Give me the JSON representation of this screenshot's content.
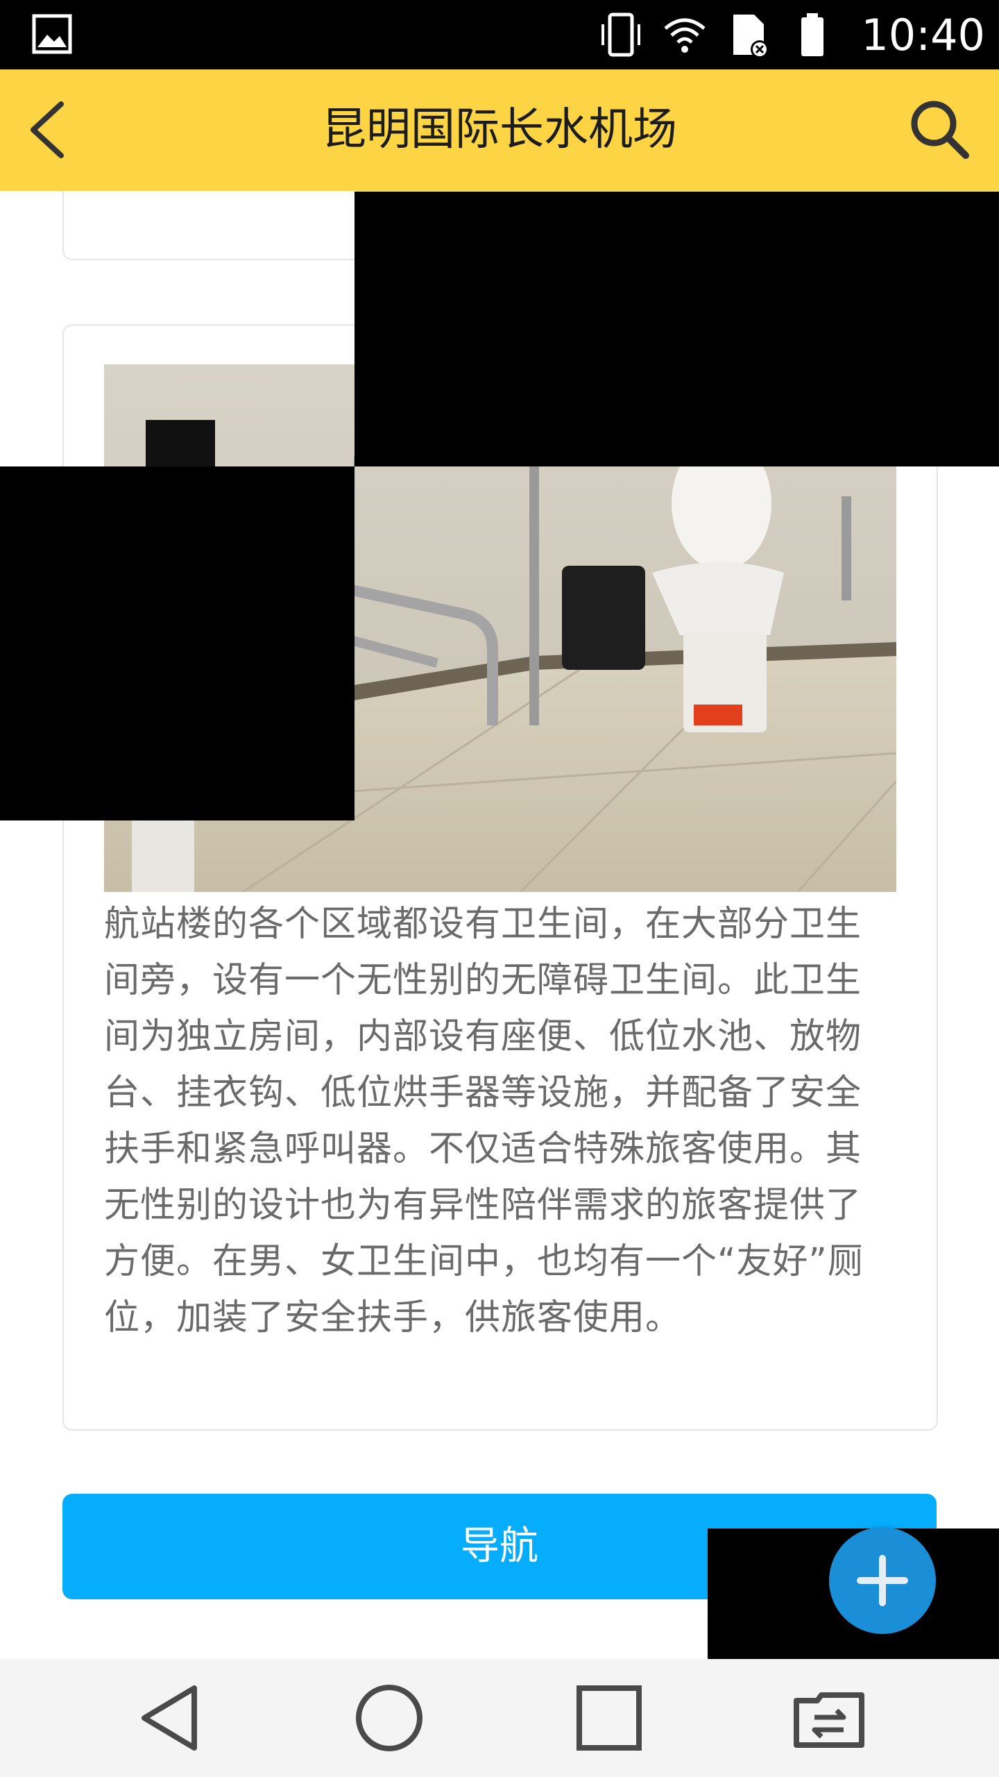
{
  "status_bar": {
    "time": "10:40",
    "icons": [
      "gallery-icon",
      "vibrate-icon",
      "wifi-icon",
      "sim-card-no-service-icon",
      "battery-full-icon"
    ]
  },
  "toolbar": {
    "title": "昆明国际长水机场",
    "back_icon": "chevron-left-icon",
    "search_icon": "search-icon"
  },
  "card": {
    "image_alt": "accessible restroom with toilet, grab bars and washbasin",
    "description": "航站楼的各个区域都设有卫生间，在大部分卫生间旁，设有一个无性别的无障碍卫生间。此卫生间为独立房间，内部设有座便、低位水池、放物台、挂衣钩、低位烘手器等设施，并配备了安全扶手和紧急呼叫器。不仅适合特殊旅客使用。其无性别的设计也为有异性陪伴需求的旅客提供了方便。在男、女卫生间中，也均有一个“友好”厕位，加装了安全扶手，供旅客使用。"
  },
  "navigate_button": {
    "label": "导航"
  },
  "fab": {
    "icon": "plus-icon"
  },
  "nav_bar": {
    "icons": [
      "back-triangle-icon",
      "home-circle-icon",
      "recents-square-icon",
      "switch-app-icon"
    ]
  },
  "colors": {
    "toolbar": "#FDD444",
    "primary_button": "#06ADFD",
    "fab": "#1a8ed6"
  }
}
